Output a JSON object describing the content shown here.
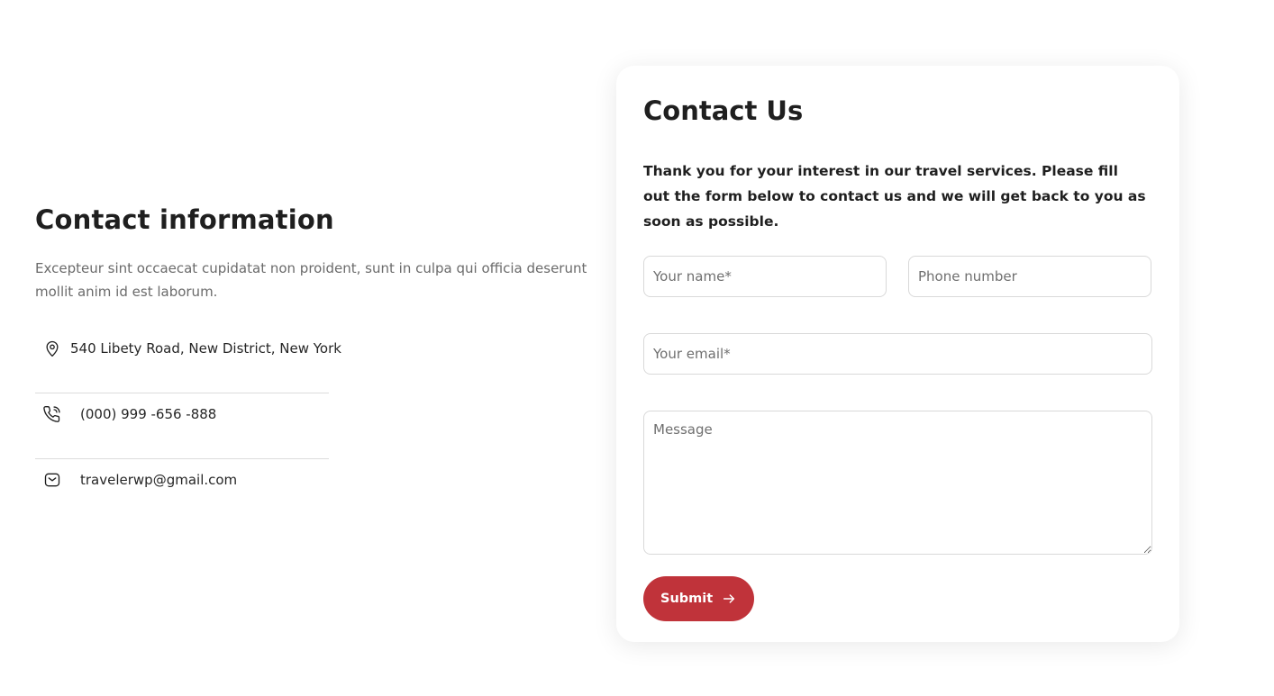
{
  "contact_info": {
    "title": "Contact information",
    "description": "Excepteur sint occaecat cupidatat non proident, sunt in culpa qui officia deserunt mollit anim id est laborum.",
    "items": [
      {
        "icon": "location-pin-icon",
        "text": "540 Libety Road, New District, New York"
      },
      {
        "icon": "phone-icon",
        "text": "(000) 999 -656 -888"
      },
      {
        "icon": "mail-icon",
        "text": "travelerwp@gmail.com"
      }
    ]
  },
  "contact_form": {
    "title": "Contact Us",
    "intro": "Thank you for your interest in our travel services. Please fill out the form below to contact us and we will get back to you as soon as possible.",
    "fields": {
      "name_placeholder": "Your name*",
      "phone_placeholder": "Phone number",
      "email_placeholder": "Your email*",
      "message_placeholder": "Message"
    },
    "submit_label": "Submit",
    "submit_icon": "arrow-right-icon"
  },
  "colors": {
    "accent": "#c0333a",
    "text_dark": "#1f1f1f",
    "text_muted": "#6b6b6b",
    "border": "#d9d9d9"
  }
}
